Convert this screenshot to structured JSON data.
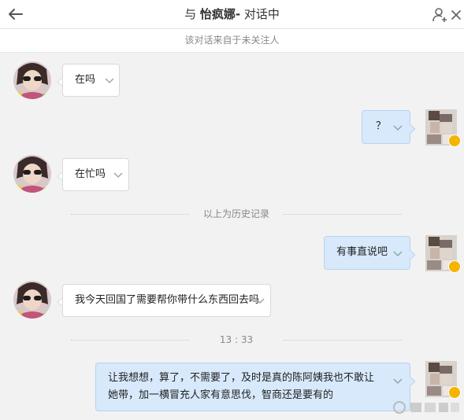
{
  "header": {
    "title_prefix": "与",
    "contact_name": "怡疯娜-",
    "title_suffix": "对话中"
  },
  "notice": "该对话来自于未关注人",
  "messages": [
    {
      "side": "in",
      "text": "在吗"
    },
    {
      "side": "out",
      "text": "？"
    },
    {
      "side": "in",
      "text": "在忙吗"
    },
    {
      "side": "out",
      "text": "有事直说吧"
    },
    {
      "side": "in",
      "text": "我今天回国了需要帮你带什么东西回去吗"
    },
    {
      "side": "out",
      "text": "让我想想，算了，不需要了，及时是真的陈阿姨我也不敢让她带，加一横冒充人家有意思伐，智商还是要有的"
    }
  ],
  "dividers": {
    "history": "以上为历史记录",
    "time": "13 : 33"
  },
  "colors": {
    "bubble_out": "#d7e9fb",
    "bubble_in": "#ffffff",
    "verified_badge": "#f5b400"
  },
  "icons": [
    "back-arrow-icon",
    "add-user-icon",
    "close-icon",
    "chevron-down-icon",
    "verified-badge-icon"
  ]
}
